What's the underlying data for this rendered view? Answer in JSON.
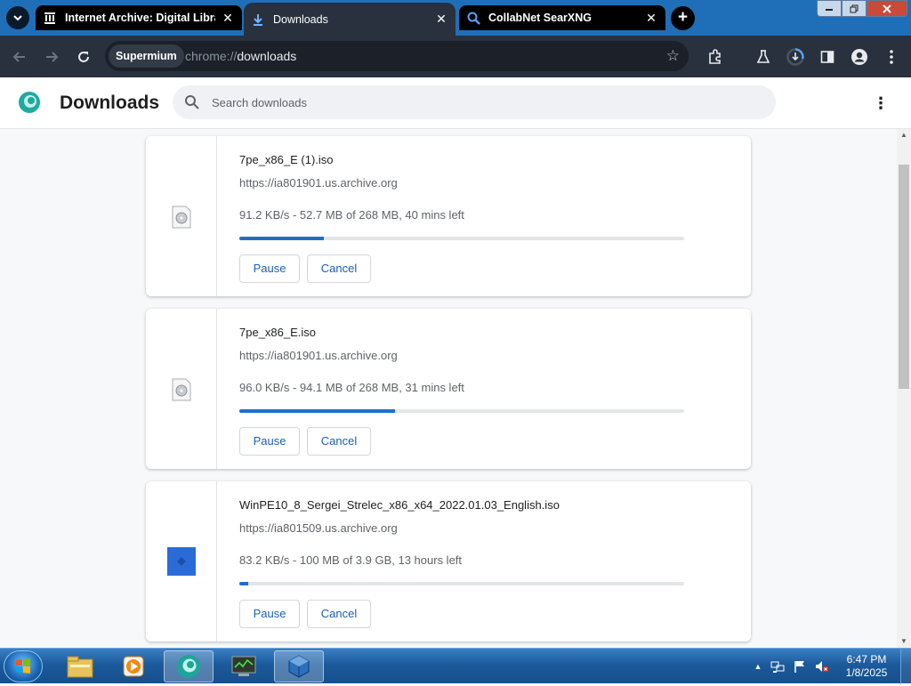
{
  "browser": {
    "tabs": [
      {
        "title": "Internet Archive: Digital Library of Free & Borrowable Books",
        "icon": "library-icon",
        "active": false
      },
      {
        "title": "Downloads",
        "icon": "download-icon",
        "active": true
      },
      {
        "title": "CollabNet SearXNG",
        "icon": "search-icon",
        "active": false
      }
    ],
    "omnibox": {
      "chip": "Supermium",
      "url_scheme": "chrome://",
      "url_path": "downloads"
    },
    "colors": {
      "tabstrip": "#1f6fb8",
      "toolbar": "#28313d",
      "accent": "#1f6fc8"
    }
  },
  "page": {
    "title": "Downloads",
    "search_placeholder": "Search downloads"
  },
  "downloads": [
    {
      "filename": "7pe_x86_E (1).iso",
      "source": "https://ia801901.us.archive.org",
      "status": "91.2 KB/s - 52.7 MB of 268 MB, 40 mins left",
      "progress": 0.19,
      "pause_label": "Pause",
      "cancel_label": "Cancel",
      "icon": "disc-image-icon"
    },
    {
      "filename": "7pe_x86_E.iso",
      "source": "https://ia801901.us.archive.org",
      "status": "96.0 KB/s - 94.1 MB of 268 MB, 31 mins left",
      "progress": 0.35,
      "pause_label": "Pause",
      "cancel_label": "Cancel",
      "icon": "disc-image-icon"
    },
    {
      "filename": "WinPE10_8_Sergei_Strelec_x86_x64_2022.01.03_English.iso",
      "source": "https://ia801509.us.archive.org",
      "status": "83.2 KB/s - 100 MB of 3.9 GB, 13 hours left",
      "progress": 0.02,
      "pause_label": "Pause",
      "cancel_label": "Cancel",
      "icon": "blue-app-icon"
    }
  ],
  "taskbar": {
    "time": "6:47 PM",
    "date": "1/8/2025",
    "apps": [
      "explorer-icon",
      "media-player-icon",
      "browser-icon",
      "task-manager-icon",
      "virtualbox-icon"
    ]
  }
}
